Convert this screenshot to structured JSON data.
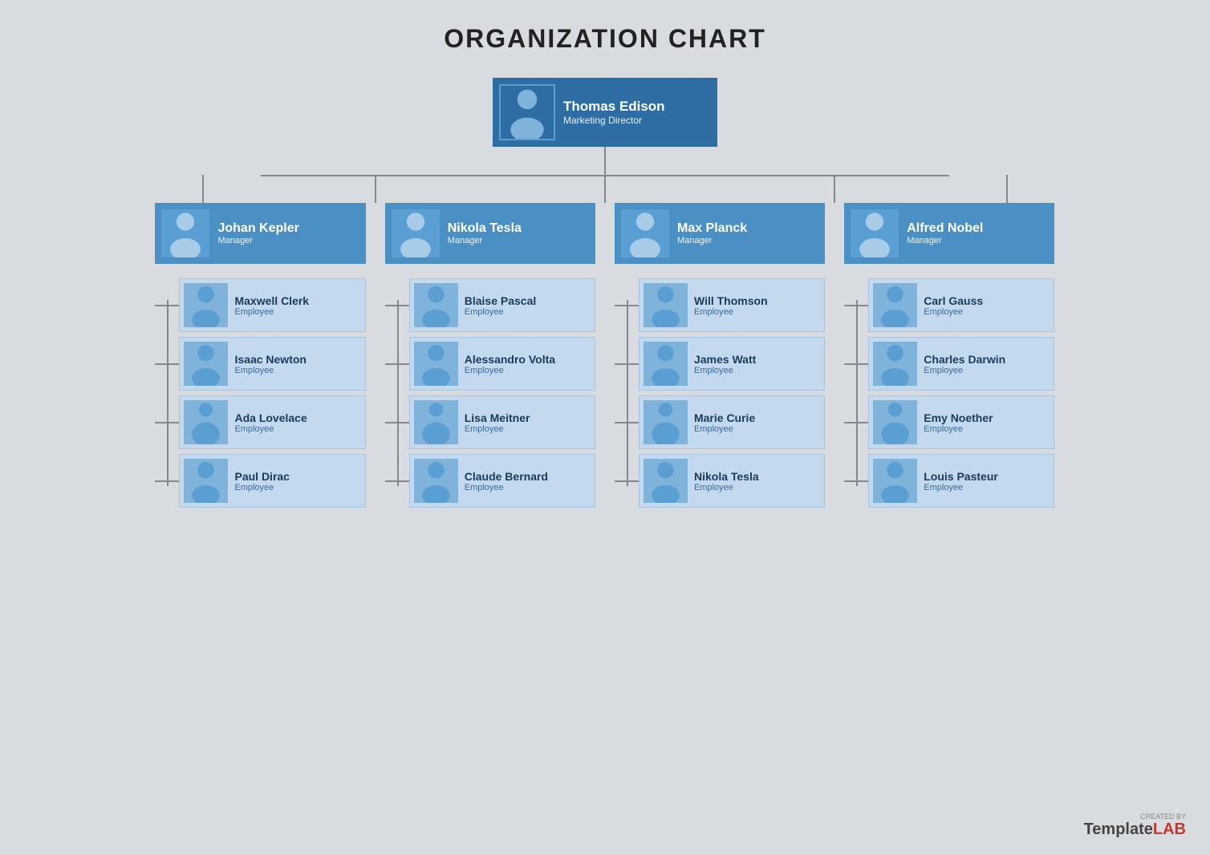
{
  "title": "ORGANIZATION CHART",
  "top": {
    "name": "Thomas Edison",
    "role": "Marketing Director"
  },
  "managers": [
    {
      "name": "Johan Kepler",
      "role": "Manager"
    },
    {
      "name": "Nikola Tesla",
      "role": "Manager"
    },
    {
      "name": "Max Planck",
      "role": "Manager"
    },
    {
      "name": "Alfred Nobel",
      "role": "Manager"
    }
  ],
  "employees": [
    [
      {
        "name": "Maxwell Clerk",
        "role": "Employee"
      },
      {
        "name": "Isaac Newton",
        "role": "Employee"
      },
      {
        "name": "Ada Lovelace",
        "role": "Employee"
      },
      {
        "name": "Paul Dirac",
        "role": "Employee"
      }
    ],
    [
      {
        "name": "Blaise Pascal",
        "role": "Employee"
      },
      {
        "name": "Alessandro Volta",
        "role": "Employee"
      },
      {
        "name": "Lisa Meitner",
        "role": "Employee"
      },
      {
        "name": "Claude Bernard",
        "role": "Employee"
      }
    ],
    [
      {
        "name": "Will Thomson",
        "role": "Employee"
      },
      {
        "name": "James Watt",
        "role": "Employee"
      },
      {
        "name": "Marie Curie",
        "role": "Employee"
      },
      {
        "name": "Nikola Tesla",
        "role": "Employee"
      }
    ],
    [
      {
        "name": "Carl Gauss",
        "role": "Employee"
      },
      {
        "name": "Charles Darwin",
        "role": "Employee"
      },
      {
        "name": "Emy Noether",
        "role": "Employee"
      },
      {
        "name": "Louis Pasteur",
        "role": "Employee"
      }
    ]
  ],
  "watermark": {
    "created_by": "CREATED BY",
    "template": "Template",
    "lab": "LAB"
  }
}
